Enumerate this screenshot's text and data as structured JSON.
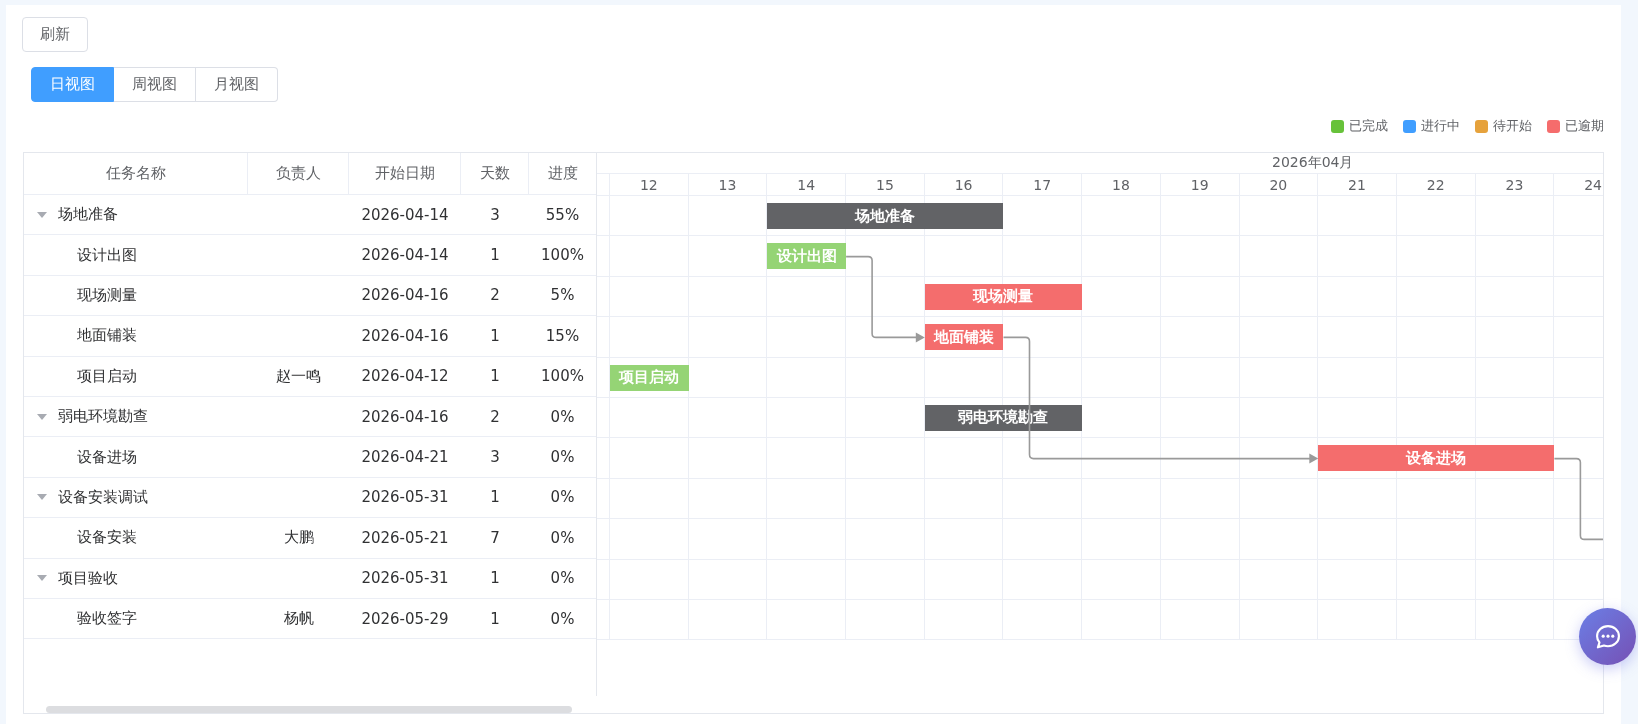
{
  "toolbar": {
    "refresh_button": "刷新"
  },
  "view_tabs": [
    {
      "label": "日视图",
      "selected": true
    },
    {
      "label": "周视图",
      "selected": false
    },
    {
      "label": "月视图",
      "selected": false
    }
  ],
  "legend": [
    {
      "label": "已完成",
      "color": "#67c23a"
    },
    {
      "label": "进行中",
      "color": "#409eff"
    },
    {
      "label": "待开始",
      "color": "#e6a23c"
    },
    {
      "label": "已逾期",
      "color": "#f56c6c"
    }
  ],
  "table": {
    "columns": [
      "任务名称",
      "负责人",
      "开始日期",
      "天数",
      "进度"
    ]
  },
  "gantt": {
    "month": "2026年04月",
    "days": [
      "12",
      "13",
      "14",
      "15",
      "16",
      "17",
      "18",
      "19",
      "20",
      "21",
      "22",
      "23",
      "24"
    ]
  },
  "tasks": [
    {
      "name": "场地准备",
      "start": "2026-04-14",
      "days": "3",
      "progress": "55%",
      "expanded": true,
      "bar": {
        "label": "场地准备",
        "color": "#626366"
      },
      "children": [
        {
          "name": "设计出图",
          "start": "2026-04-14",
          "days": "1",
          "progress": "100%",
          "bar": {
            "label": "设计出图",
            "color": "#95d475"
          }
        },
        {
          "name": "现场测量",
          "start": "2026-04-16",
          "days": "2",
          "progress": "5%",
          "bar": {
            "label": "现场测量",
            "color": "#f46d6d"
          }
        },
        {
          "name": "地面铺装",
          "start": "2026-04-16",
          "days": "1",
          "progress": "15%",
          "bar": {
            "label": "地面铺装",
            "color": "#f46d6d"
          }
        },
        {
          "name": "项目启动",
          "owner": "赵一鸣",
          "start": "2026-04-12",
          "days": "1",
          "progress": "100%",
          "bar": {
            "label": "项目启动",
            "color": "#95d475"
          }
        }
      ]
    },
    {
      "name": "弱电环境勘查",
      "start": "2026-04-16",
      "days": "2",
      "progress": "0%",
      "expanded": true,
      "bar": {
        "label": "弱电环境勘查",
        "color": "#626366"
      },
      "children": [
        {
          "name": "设备进场",
          "start": "2026-04-21",
          "days": "3",
          "progress": "0%",
          "bar": {
            "label": "设备进场",
            "color": "#f46d6d"
          }
        }
      ]
    },
    {
      "name": "设备安装调试",
      "start": "2026-05-31",
      "days": "1",
      "progress": "0%",
      "expanded": true,
      "children": [
        {
          "name": "设备安装",
          "owner": "大鹏",
          "start": "2026-05-21",
          "days": "7",
          "progress": "0%"
        }
      ]
    },
    {
      "name": "项目验收",
      "start": "2026-05-31",
      "days": "1",
      "progress": "0%",
      "expanded": true,
      "children": [
        {
          "name": "验收签字",
          "owner": "杨帆",
          "start": "2026-05-29",
          "days": "1",
          "progress": "0%"
        }
      ]
    }
  ]
}
